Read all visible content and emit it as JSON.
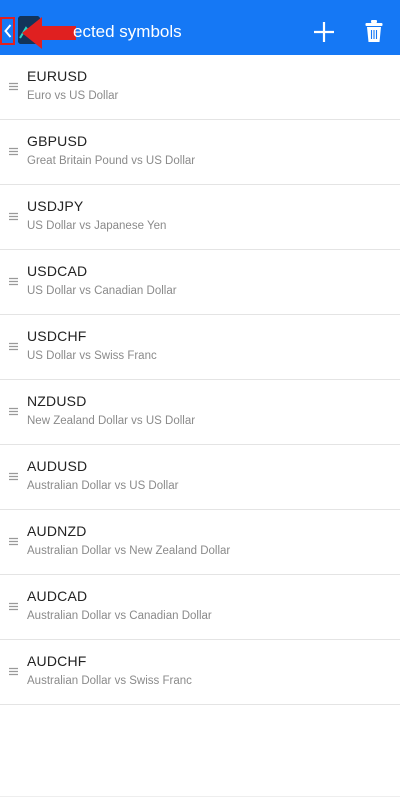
{
  "header": {
    "title": "Selected symbols",
    "title_visible": "ected symbols",
    "background": "#1578f5",
    "back_icon": "chevron-left-icon",
    "add_icon": "plus-icon",
    "delete_icon": "trash-icon",
    "annotation_color": "#e02020"
  },
  "symbols": [
    {
      "symbol": "EURUSD",
      "description": "Euro vs US Dollar"
    },
    {
      "symbol": "GBPUSD",
      "description": "Great Britain Pound vs US Dollar"
    },
    {
      "symbol": "USDJPY",
      "description": "US Dollar vs Japanese Yen"
    },
    {
      "symbol": "USDCAD",
      "description": "US Dollar vs Canadian Dollar"
    },
    {
      "symbol": "USDCHF",
      "description": "US Dollar vs Swiss Franc"
    },
    {
      "symbol": "NZDUSD",
      "description": "New Zealand Dollar vs US Dollar"
    },
    {
      "symbol": "AUDUSD",
      "description": "Australian Dollar vs US Dollar"
    },
    {
      "symbol": "AUDNZD",
      "description": "Australian Dollar vs New Zealand Dollar"
    },
    {
      "symbol": "AUDCAD",
      "description": "Australian Dollar vs Canadian Dollar"
    },
    {
      "symbol": "AUDCHF",
      "description": "Australian Dollar vs Swiss Franc"
    }
  ]
}
